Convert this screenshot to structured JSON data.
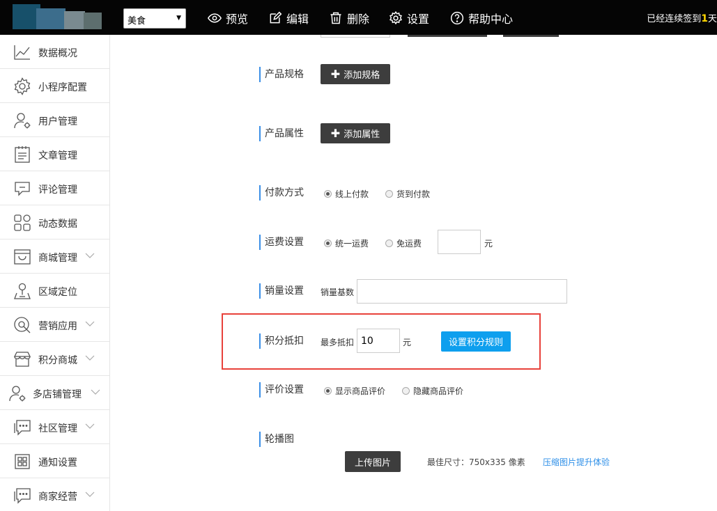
{
  "topbar": {
    "category_value": "美食",
    "nav": {
      "preview": "预览",
      "edit": "编辑",
      "delete": "删除",
      "settings": "设置",
      "help": "帮助中心"
    },
    "checkin_prefix": "已经连续签到",
    "checkin_days": "1",
    "checkin_suffix": "天"
  },
  "sidebar": {
    "items": [
      {
        "label": "数据概况",
        "icon": "chart-line-icon"
      },
      {
        "label": "小程序配置",
        "icon": "gear-icon"
      },
      {
        "label": "用户管理",
        "icon": "user-gear-icon"
      },
      {
        "label": "文章管理",
        "icon": "article-icon"
      },
      {
        "label": "评论管理",
        "icon": "comment-icon"
      },
      {
        "label": "动态数据",
        "icon": "grid-icon"
      },
      {
        "label": "商城管理",
        "icon": "shop-box-icon"
      },
      {
        "label": "区域定位",
        "icon": "location-pin-icon"
      },
      {
        "label": "营销应用",
        "icon": "marketing-icon"
      },
      {
        "label": "积分商城",
        "icon": "store-icon"
      },
      {
        "label": "多店铺管理",
        "icon": "user-gear-icon"
      },
      {
        "label": "社区管理",
        "icon": "chat-icon"
      },
      {
        "label": "通知设置",
        "icon": "notice-icon"
      },
      {
        "label": "商家经营",
        "icon": "chat-icon"
      }
    ]
  },
  "form": {
    "spec": {
      "label": "产品规格",
      "button": "添加规格"
    },
    "attr": {
      "label": "产品属性",
      "button": "添加属性"
    },
    "payment": {
      "label": "付款方式",
      "option1": "线上付款",
      "option2": "货到付款"
    },
    "shipping": {
      "label": "运费设置",
      "option1": "统一运费",
      "option2": "免运费",
      "value": "",
      "unit": "元"
    },
    "sales": {
      "label": "销量设置",
      "field_label": "销量基数",
      "value": ""
    },
    "points": {
      "label": "积分抵扣",
      "field_label": "最多抵扣",
      "value": "10",
      "unit": "元",
      "button": "设置积分规则"
    },
    "review": {
      "label": "评价设置",
      "option1": "显示商品评价",
      "option2": "隐藏商品评价"
    },
    "carousel": {
      "label": "轮播图",
      "button": "上传图片",
      "hint": "最佳尺寸：750x335 像素",
      "link": "压缩图片提升体验"
    }
  }
}
